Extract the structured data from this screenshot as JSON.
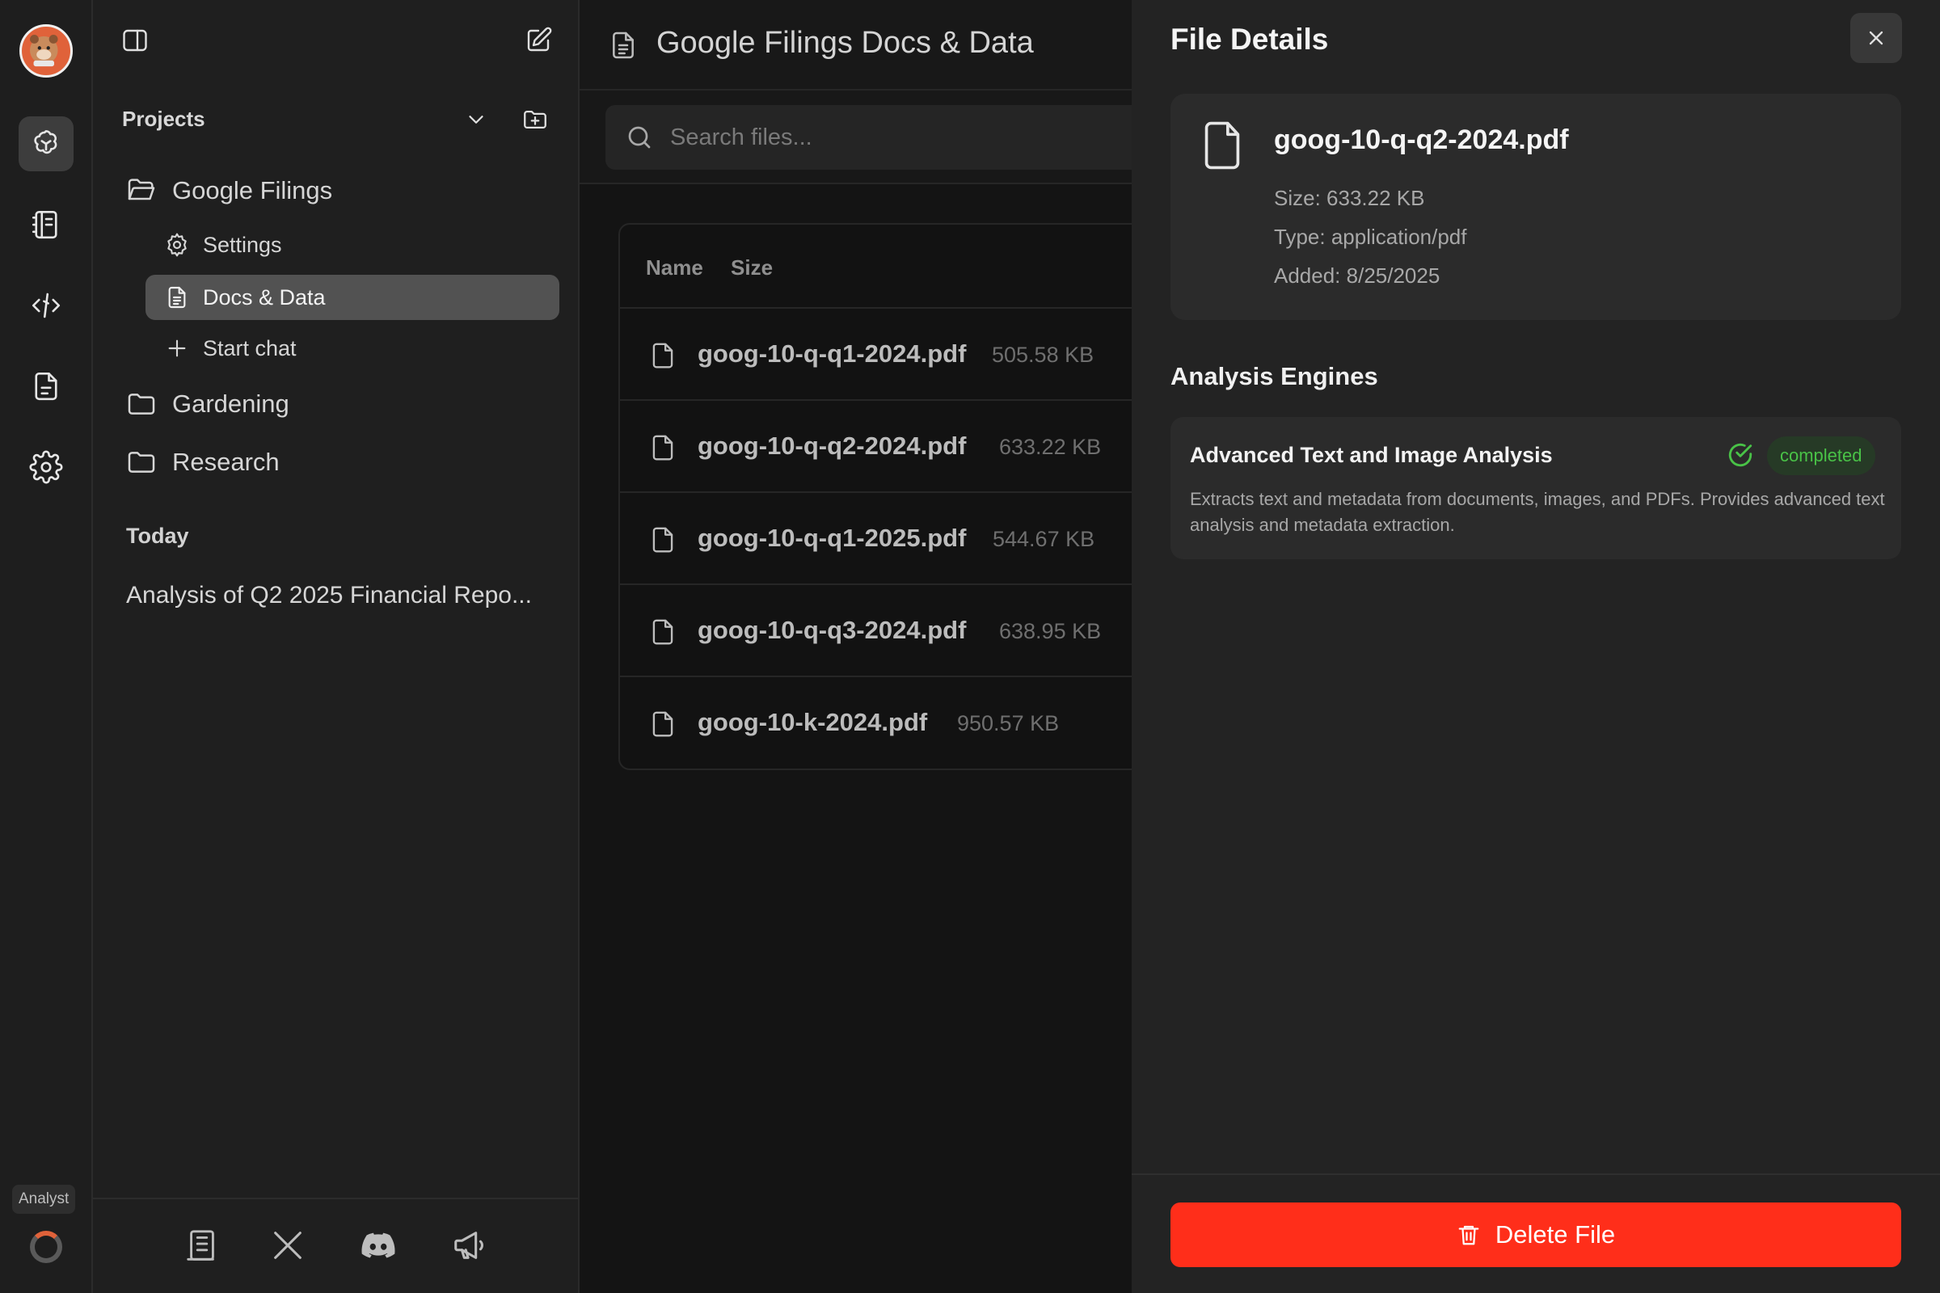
{
  "rail": {
    "items": [
      {
        "name": "assistant-icon",
        "active": true
      },
      {
        "name": "notebook-icon",
        "active": false
      },
      {
        "name": "code-pen-icon",
        "active": false
      },
      {
        "name": "document-icon",
        "active": false
      },
      {
        "name": "settings-icon",
        "active": false
      }
    ],
    "badge": "Analyst"
  },
  "sidebar": {
    "projects_label": "Projects",
    "projects": [
      {
        "label": "Google Filings",
        "open": true,
        "children": [
          {
            "label": "Settings",
            "icon": "gear-icon"
          },
          {
            "label": "Docs & Data",
            "icon": "document-icon",
            "selected": true
          },
          {
            "label": "Start chat",
            "icon": "plus-icon"
          }
        ]
      },
      {
        "label": "Gardening",
        "open": false
      },
      {
        "label": "Research",
        "open": false
      }
    ],
    "today_label": "Today",
    "chats": [
      "Analysis of Q2 2025 Financial Repo..."
    ],
    "footer_icons": [
      "docs-icon",
      "x-icon",
      "discord-icon",
      "megaphone-icon"
    ]
  },
  "main": {
    "title": "Google Filings Docs & Data",
    "search_placeholder": "Search files...",
    "columns": {
      "name": "Name",
      "size": "Size"
    },
    "files": [
      {
        "name": "goog-10-q-q1-2024.pdf",
        "size": "505.58 KB"
      },
      {
        "name": "goog-10-q-q2-2024.pdf",
        "size": "633.22 KB"
      },
      {
        "name": "goog-10-q-q1-2025.pdf",
        "size": "544.67 KB"
      },
      {
        "name": "goog-10-q-q3-2024.pdf",
        "size": "638.95 KB"
      },
      {
        "name": "goog-10-k-2024.pdf",
        "size": "950.57 KB"
      }
    ]
  },
  "details": {
    "title": "File Details",
    "file": {
      "name": "goog-10-q-q2-2024.pdf",
      "size": "Size: 633.22 KB",
      "type": "Type: application/pdf",
      "added": "Added: 8/25/2025"
    },
    "engines_label": "Analysis Engines",
    "engine": {
      "name": "Advanced Text and Image Analysis",
      "status": "completed",
      "description": "Extracts text and metadata from documents, images, and PDFs. Provides advanced text analysis and metadata extraction."
    },
    "delete_label": "Delete File"
  },
  "colors": {
    "accent": "#ff2e1a",
    "status_ok": "#49c247",
    "brand": "#e0623a"
  }
}
